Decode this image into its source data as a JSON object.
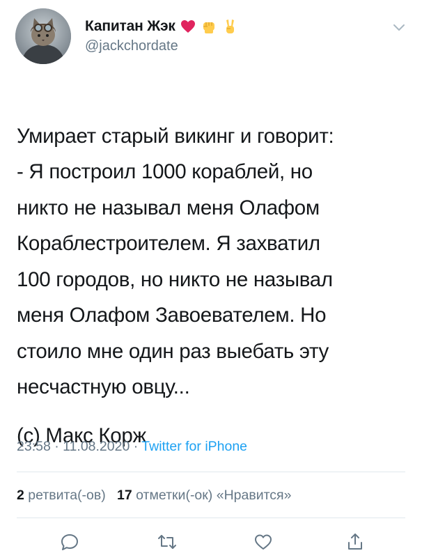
{
  "author": {
    "display_name": "Капитан Жэк",
    "handle": "@jackchordate",
    "emoji_icons": [
      "red-heart-icon",
      "raised-fist-icon",
      "victory-hand-icon"
    ]
  },
  "tweet": {
    "text": "Умирает старый викинг и говорит:\n- Я построил 1000 кораблей, но\nникто не называл меня Олафом\nКораблестроителем. Я захватил\n100 городов, но никто не называл\nменя Олафом Завоевателем. Но\nстоило мне один раз выебать эту\nнесчастную овцу...",
    "credit": "(с) Макс Корж"
  },
  "meta": {
    "time": "23:58",
    "separator": " · ",
    "date": "11.08.2020",
    "source": "Twitter for iPhone"
  },
  "stats": {
    "retweets_count": "2",
    "retweets_label": "ретвита(-ов)",
    "likes_count": "17",
    "likes_label": "отметки(-ок) «Нравится»"
  },
  "colors": {
    "text": "#14171a",
    "secondary": "#657786",
    "link": "#1da1f2",
    "divider": "#e1e8ed"
  },
  "actions": [
    "reply-icon",
    "retweet-icon",
    "like-icon",
    "share-icon"
  ]
}
